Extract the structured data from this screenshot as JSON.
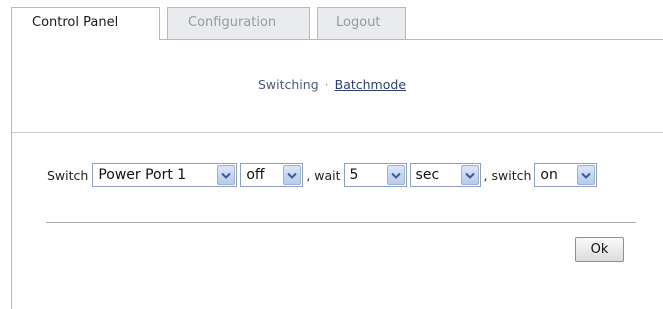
{
  "tabs": [
    {
      "label": "Control Panel",
      "active": true
    },
    {
      "label": "Configuration",
      "active": false
    },
    {
      "label": "Logout",
      "active": false
    }
  ],
  "subnav": {
    "switching": "Switching",
    "separator": "·",
    "batchmode": "Batchmode"
  },
  "form": {
    "label_switch": "Switch",
    "port": "Power Port 1",
    "state1": "off",
    "comma_wait": ", wait",
    "wait_value": "5",
    "unit": "sec",
    "comma_switch": ", switch",
    "state2": "on"
  },
  "ok_label": "Ok",
  "colors": {
    "tab_inactive_bg": "#e9ebee",
    "select_border": "#8aa0c4",
    "link": "#2a3f70"
  },
  "icons": {
    "dropdown": "chevron-down-icon"
  }
}
